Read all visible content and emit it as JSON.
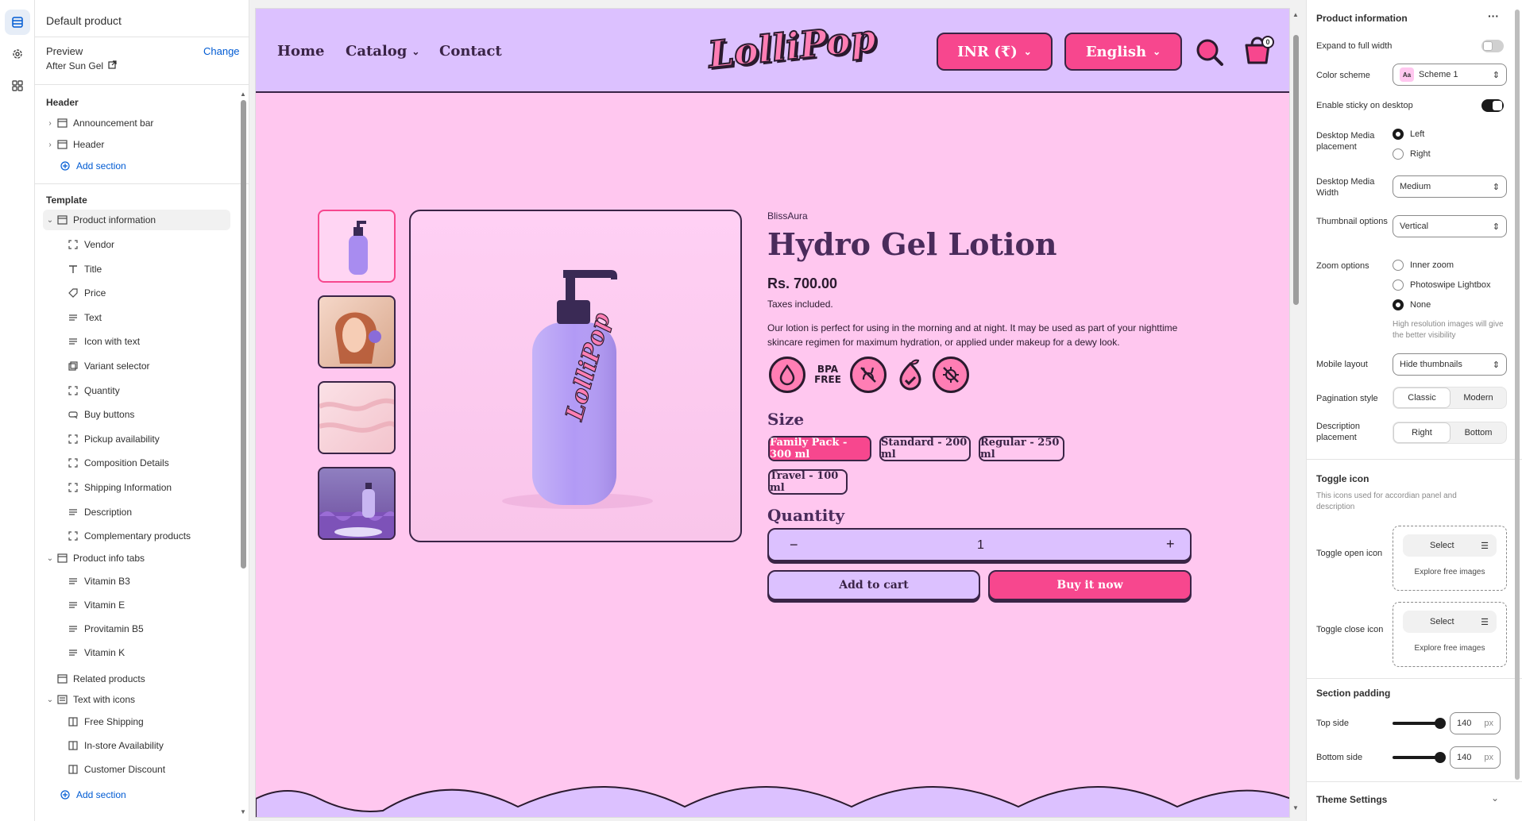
{
  "left_panel": {
    "title": "Default product",
    "preview_label": "Preview",
    "preview_change": "Change",
    "preview_value": "After Sun Gel",
    "header_group": "Header",
    "header_items": [
      "Announcement bar",
      "Header"
    ],
    "add_section": "Add section",
    "template_group": "Template",
    "product_information": "Product information",
    "product_blocks": [
      "Vendor",
      "Title",
      "Price",
      "Text",
      "Icon with text",
      "Variant selector",
      "Quantity",
      "Buy buttons",
      "Pickup availability",
      "Composition Details",
      "Shipping Information",
      "Description",
      "Complementary products"
    ],
    "product_info_tabs": "Product info tabs",
    "tab_blocks": [
      "Vitamin B3",
      "Vitamin E",
      "Provitamin B5",
      "Vitamin K"
    ],
    "related_products": "Related products",
    "text_with_icons": "Text with icons",
    "icon_blocks": [
      "Free Shipping",
      "In-store Availability",
      "Customer Discount"
    ],
    "add_section_2": "Add section"
  },
  "store": {
    "nav": [
      "Home",
      "Catalog",
      "Contact"
    ],
    "logo_text": "LolliPop",
    "currency": "INR (₹)",
    "language": "English",
    "cart_count": "0"
  },
  "product": {
    "vendor": "BlissAura",
    "title": "Hydro Gel Lotion",
    "price": "Rs. 700.00",
    "tax_note": "Taxes included.",
    "description": "Our lotion is perfect for using in the morning and at night. It may be used as part of your nighttime skincare regimen for maximum hydration, or applied under makeup for a dewy look.",
    "badge_bpa": "BPA FREE",
    "size_label": "Size",
    "sizes": [
      "Family Pack - 300 ml",
      "Standard - 200 ml",
      "Regular - 250 ml",
      "Travel - 100 ml"
    ],
    "selected_size": "Family Pack - 300 ml",
    "quantity_label": "Quantity",
    "quantity_value": "1",
    "add_to_cart": "Add to cart",
    "buy_now": "Buy it now",
    "bottle_label": "LolliPop"
  },
  "right_panel": {
    "title": "Product information",
    "more": "···",
    "expand_full_width": "Expand to full width",
    "color_scheme_label": "Color scheme",
    "color_scheme_value": "Scheme 1",
    "color_scheme_swatch": "Aa",
    "sticky_label": "Enable sticky on desktop",
    "media_placement_label": "Desktop Media placement",
    "media_placement_options": [
      "Left",
      "Right"
    ],
    "media_width_label": "Desktop Media Width",
    "media_width_value": "Medium",
    "thumb_options_label": "Thumbnail options",
    "thumb_options_value": "Vertical",
    "zoom_label": "Zoom options",
    "zoom_options": [
      "Inner zoom",
      "Photoswipe Lightbox",
      "None"
    ],
    "zoom_help": "High resolution images will give the better visibility",
    "mobile_layout_label": "Mobile layout",
    "mobile_layout_value": "Hide thumbnails",
    "pagination_label": "Pagination style",
    "pagination_options": [
      "Classic",
      "Modern"
    ],
    "desc_placement_label": "Description placement",
    "desc_placement_options": [
      "Right",
      "Bottom"
    ],
    "toggle_icon_head": "Toggle icon",
    "toggle_icon_help": "This icons used for accordian panel and description",
    "toggle_open_label": "Toggle open icon",
    "toggle_close_label": "Toggle close icon",
    "select": "Select",
    "explore": "Explore free images",
    "section_padding_head": "Section padding",
    "top_side_label": "Top side",
    "top_side_value": "140",
    "bottom_side_label": "Bottom side",
    "bottom_side_value": "140",
    "unit": "px",
    "theme_settings": "Theme Settings"
  },
  "colors": {
    "header_bg": "#dcc1ff",
    "page_bg": "#ffc7ef",
    "accent_pink": "#f7478e",
    "ink": "#3a2446",
    "link_blue": "#005bd3"
  }
}
